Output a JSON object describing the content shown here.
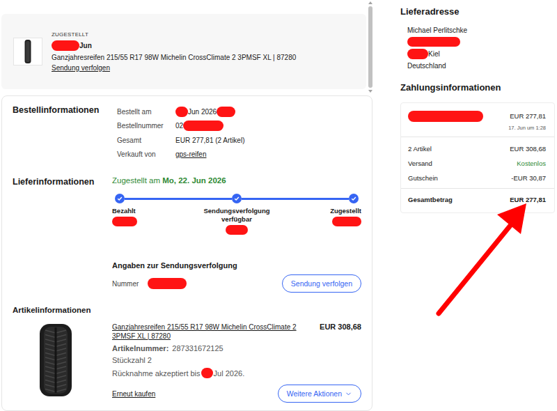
{
  "shipment_card": {
    "status": "ZUGESTELLT",
    "date": [
      {
        "redacted": true
      },
      {
        "text": "Jun"
      }
    ],
    "title": "Ganzjahresreifen 215/55 R17 98W Michelin CrossClimate 2 3PMSF XL | 87280",
    "link": "Sendung verfolgen"
  },
  "order_info": {
    "heading": "Bestellinformationen",
    "rows": [
      {
        "label": "Bestellt am",
        "value": [
          {
            "redacted": true
          },
          {
            "text": "Jun 2026"
          },
          {
            "redacted": true
          }
        ],
        "link": false
      },
      {
        "label": "Bestellnummer",
        "value": [
          {
            "text": "02"
          },
          {
            "redacted": true
          }
        ],
        "link": false
      },
      {
        "label": "Gesamt",
        "value": [
          {
            "text": "EUR 277,81 (2 Artikel)"
          }
        ],
        "link": false
      },
      {
        "label": "Verkauft von",
        "value": [
          {
            "text": "gps-reifen"
          }
        ],
        "link": true
      }
    ]
  },
  "delivery_info": {
    "heading": "Lieferinformationen",
    "status_prefix": "Zugestellt am",
    "status_date": "Mo, 22. Jun 2026",
    "steps": [
      {
        "label": "Bezahlt",
        "done": true,
        "date_redacted": true
      },
      {
        "label": "Sendungsverfolgung verfügbar",
        "done": true,
        "date_redacted": true
      },
      {
        "label": "Zugestellt",
        "done": true,
        "date_redacted": true
      }
    ],
    "tracking_heading": "Angaben zur Sendungsverfolgung",
    "tracking_label": "Nummer",
    "tracking_number_redacted": true,
    "tracking_button": "Sendung verfolgen"
  },
  "item_info": {
    "heading": "Artikelinformationen",
    "title": "Ganzjahresreifen 215/55 R17 98W Michelin CrossClimate 2 3PMSF XL | 87280",
    "price": "EUR 308,68",
    "item_number_label": "Artikelnummer:",
    "item_number": "287331672125",
    "quantity": "Stückzahl 2",
    "return": [
      {
        "text": "Rücknahme akzeptiert bis"
      },
      {
        "redacted": true
      },
      {
        "text": "Jul 2026."
      }
    ],
    "buy_again": "Erneut kaufen",
    "more_button": "Weitere Aktionen"
  },
  "address": {
    "heading": "Lieferadresse",
    "name": "Michael Perlitschke",
    "street_redacted": true,
    "city": [
      {
        "redacted": true
      },
      {
        "text": "Kiel"
      }
    ],
    "country": "Deutschland"
  },
  "payment": {
    "heading": "Zahlungsinformationen",
    "method_redacted": true,
    "amount": "EUR 277,81",
    "time": "17. Jun um 1:28",
    "lines": [
      {
        "label": "2 Artikel",
        "value": "EUR 308,68",
        "kind": "plain"
      },
      {
        "label": "Versand",
        "value": "Kostenlos",
        "kind": "free"
      },
      {
        "label": "Gutschein",
        "value": "-EUR 30,87",
        "kind": "plain"
      }
    ],
    "total": {
      "label": "Gesamtbetrag",
      "value": "EUR 277,81",
      "highlighted": true
    }
  }
}
